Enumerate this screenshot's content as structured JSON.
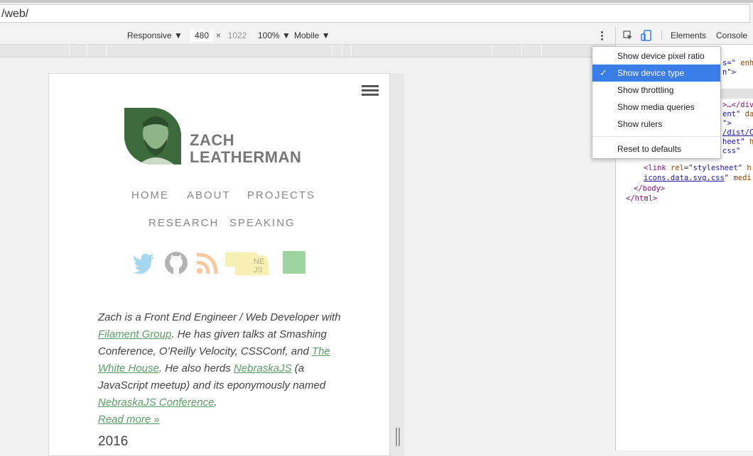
{
  "address_bar": {
    "url": "/web/"
  },
  "device_toolbar": {
    "device": "Responsive",
    "width": "480",
    "times": "×",
    "height": "1022",
    "zoom": "100%",
    "mode": "Mobile"
  },
  "site": {
    "name_line1": "ZACH",
    "name_line2": "LEATHERMAN",
    "nav": [
      "HOME",
      "ABOUT",
      "PROJECTS",
      "RESEARCH",
      "SPEAKING"
    ],
    "social_icons": [
      "twitter-icon",
      "github-icon",
      "rss-icon",
      "nebraskajs-icon",
      "green-square-icon"
    ],
    "nejs_text": "NE\nJS",
    "bio": {
      "t1": "Zach is a Front End Engineer / Web Developer with ",
      "l1": "Filament Group",
      "t2": ". He has given talks at Smashing Conference, O’Reilly Velocity, CSSConf, and ",
      "l2": "The White House",
      "t3": ". He also herds ",
      "l3": "NebraskaJS",
      "t4": " (a JavaScript meetup) and its eponymously named ",
      "l4": "NebraskaJS Conference",
      "t5": ".",
      "l5": "Read more »"
    },
    "year": "2016"
  },
  "devtools": {
    "tabs": {
      "elements": "Elements",
      "console": "Console"
    },
    "code": {
      "l1a": "s=\"",
      "l1b": " enha",
      "l2": "n\">",
      "l3": ">…</div",
      "l4a": "ent\"",
      "l4b": " dat",
      "l5": "\">",
      "l6": "/dist/C",
      "l7a": "heet\"",
      "l7b": " h",
      "l8": "css\"",
      "l9a": "<link",
      "l9b": "rel",
      "l9c": "\"stylesheet\"",
      "l9d": " h",
      "l10a": "icons.data.svg.css",
      "l10b": "\"",
      "l10c": " medi",
      "l11": "</body>",
      "l12": "</html>"
    }
  },
  "menu": {
    "items": [
      {
        "label": "Show device pixel ratio",
        "checked": false
      },
      {
        "label": "Show device type",
        "checked": true
      },
      {
        "label": "Show throttling",
        "checked": false
      },
      {
        "label": "Show media queries",
        "checked": false
      },
      {
        "label": "Show rulers",
        "checked": false
      }
    ],
    "reset": "Reset to defaults",
    "check_glyph": "✓"
  }
}
